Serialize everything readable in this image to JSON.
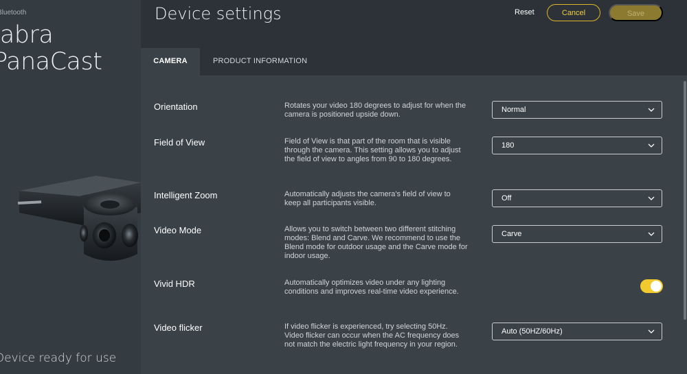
{
  "sidebar": {
    "connection": "Bluetooth",
    "device_name": "Jabra PanaCast",
    "device_name_line1": "Jabra",
    "device_name_line2": "PanaCast",
    "status": "Device ready for use"
  },
  "header": {
    "title": "Device settings",
    "reset_label": "Reset",
    "cancel_label": "Cancel",
    "save_label": "Save"
  },
  "tabs": [
    {
      "label": "CAMERA",
      "active": true
    },
    {
      "label": "PRODUCT INFORMATION",
      "active": false
    }
  ],
  "settings": [
    {
      "label": "Orientation",
      "description": "Rotates your video 180 degrees to adjust for when the camera is positioned upside down.",
      "control": "select",
      "value": "Normal"
    },
    {
      "label": "Field of View",
      "description": "Field of View is that part of the room that is visible through the camera. This setting allows you to adjust the field of view to angles from 90 to 180 degrees.",
      "control": "select",
      "value": "180"
    },
    {
      "label": "Intelligent Zoom",
      "description": "Automatically adjusts the camera's field of view to keep all participants visible.",
      "control": "select",
      "value": "Off"
    },
    {
      "label": "Video Mode",
      "description": "Allows you to switch between two different stitching modes: Blend and Carve. We recommend to use the Blend mode for outdoor usage and the Carve mode for indoor usage.",
      "control": "select",
      "value": "Carve"
    },
    {
      "label": "Vivid HDR",
      "description": "Automatically optimizes video under any lighting conditions and improves real-time video experience.",
      "control": "toggle",
      "value": true
    },
    {
      "label": "Video flicker",
      "description": "If video flicker is experienced, try selecting 50Hz. Video flicker can occur when the AC frequency does not match the electric light frequency in your region.",
      "control": "select",
      "value": "Auto (50HZ/60Hz)"
    }
  ],
  "colors": {
    "accent": "#f1cb2d",
    "save_disabled": "#8c7a30",
    "panel_bg": "#3a4147",
    "header_bg": "#2c3237",
    "sidebar_bg": "#343b41"
  },
  "icons": {
    "select_arrow": "chevron-down-icon"
  }
}
